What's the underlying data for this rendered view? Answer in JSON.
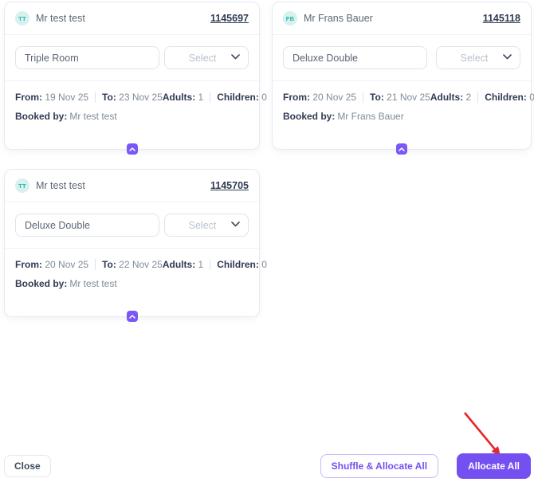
{
  "labels": {
    "from": "From:",
    "to": "To:",
    "adults": "Adults:",
    "children": "Children:",
    "booked_by": "Booked by:"
  },
  "cards": [
    {
      "initials": "TT",
      "guest_name": "Mr test test",
      "booking_id": "1145697",
      "room_type": "Triple Room",
      "room_select_placeholder": "Select",
      "from_value": "19 Nov 25",
      "to_value": "23 Nov 25",
      "adults_value": "1",
      "children_value": "0",
      "booked_by_value": "Mr test test"
    },
    {
      "initials": "FB",
      "guest_name": "Mr Frans Bauer",
      "booking_id": "1145118",
      "room_type": "Deluxe Double",
      "room_select_placeholder": "Select",
      "from_value": "20 Nov 25",
      "to_value": "21 Nov 25",
      "adults_value": "2",
      "children_value": "0",
      "booked_by_value": "Mr Frans Bauer"
    },
    {
      "initials": "TT",
      "guest_name": "Mr test test",
      "booking_id": "1145705",
      "room_type": "Deluxe Double",
      "room_select_placeholder": "Select",
      "from_value": "20 Nov 25",
      "to_value": "22 Nov 25",
      "adults_value": "1",
      "children_value": "0",
      "booked_by_value": "Mr test test"
    }
  ],
  "footer": {
    "close_label": "Close",
    "shuffle_allocate_label": "Shuffle & Allocate All",
    "allocate_label": "Allocate All"
  },
  "icons": {
    "room_select": "chevron-down-icon",
    "card_collapse": "chevron-up-icon",
    "annotation": "red-arrow"
  },
  "colors": {
    "accent_purple": "#7450f1",
    "avatar_teal_bg": "#d7f1ee",
    "avatar_teal_text": "#2ab3a7",
    "dark_text": "#2f3b52",
    "muted_text": "#7f8a99",
    "annotation_red": "#e8272c"
  }
}
